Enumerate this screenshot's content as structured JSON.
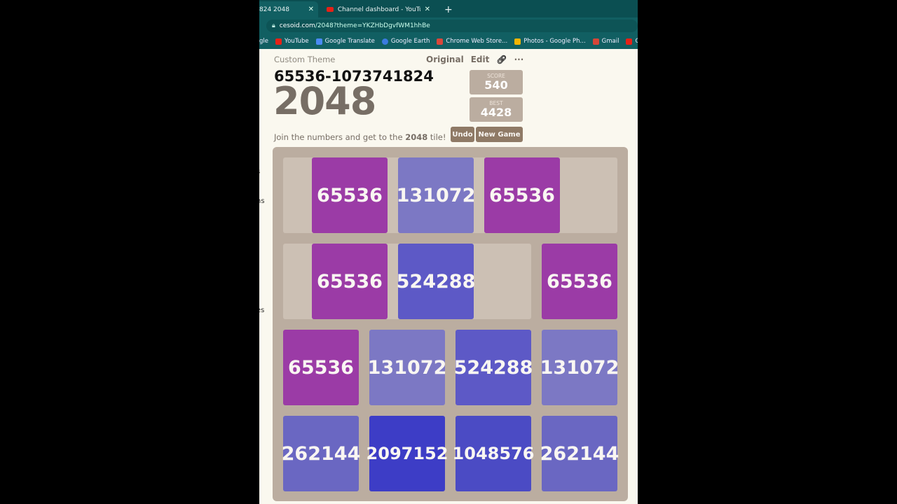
{
  "browser": {
    "tabs": [
      {
        "label": "824 2048",
        "active": true
      },
      {
        "label": "Channel dashboard - YouTube St",
        "active": false
      }
    ],
    "url_host": "cesoid.com",
    "url_path": "/2048?theme=YKZHbDgvfWM1hhBe",
    "bookmarks": [
      {
        "label": "gle",
        "icon": "none"
      },
      {
        "label": "YouTube",
        "icon": "youtube-icon"
      },
      {
        "label": "Google Translate",
        "icon": "translate-icon"
      },
      {
        "label": "Google Earth",
        "icon": "earth-icon"
      },
      {
        "label": "Chrome Web Store...",
        "icon": "store-icon"
      },
      {
        "label": "Photos - Google Ph...",
        "icon": "photos-icon"
      },
      {
        "label": "Gmail",
        "icon": "gmail-icon"
      },
      {
        "label": "Ch",
        "icon": "youtube-icon"
      }
    ]
  },
  "side_fragments": [
    "s",
    "ns",
    "es"
  ],
  "header": {
    "theme_label": "Custom Theme",
    "original": "Original",
    "edit": "Edit",
    "more": "···",
    "subtitle": "65536-1073741824",
    "title": "2048",
    "score_label": "SCORE",
    "score": "540",
    "best_label": "BEST",
    "best": "4428",
    "intro_pre": "Join the numbers and get to the ",
    "intro_bold": "2048",
    "intro_post": " tile!",
    "undo": "Undo",
    "new_game": "New Game"
  },
  "board": [
    [
      null,
      65536,
      131072,
      65536
    ],
    [
      null,
      65536,
      524288,
      65536
    ],
    [
      65536,
      131072,
      524288,
      131072
    ],
    [
      262144,
      2097152,
      1048576,
      262144
    ]
  ],
  "tile_colors": {
    "65536": "#9b3ba6",
    "131072": "#7c78c4",
    "262144": "#6a67c2",
    "524288": "#5d59c6",
    "1048576": "#4b4bc4",
    "2097152": "#3d3dc6"
  }
}
